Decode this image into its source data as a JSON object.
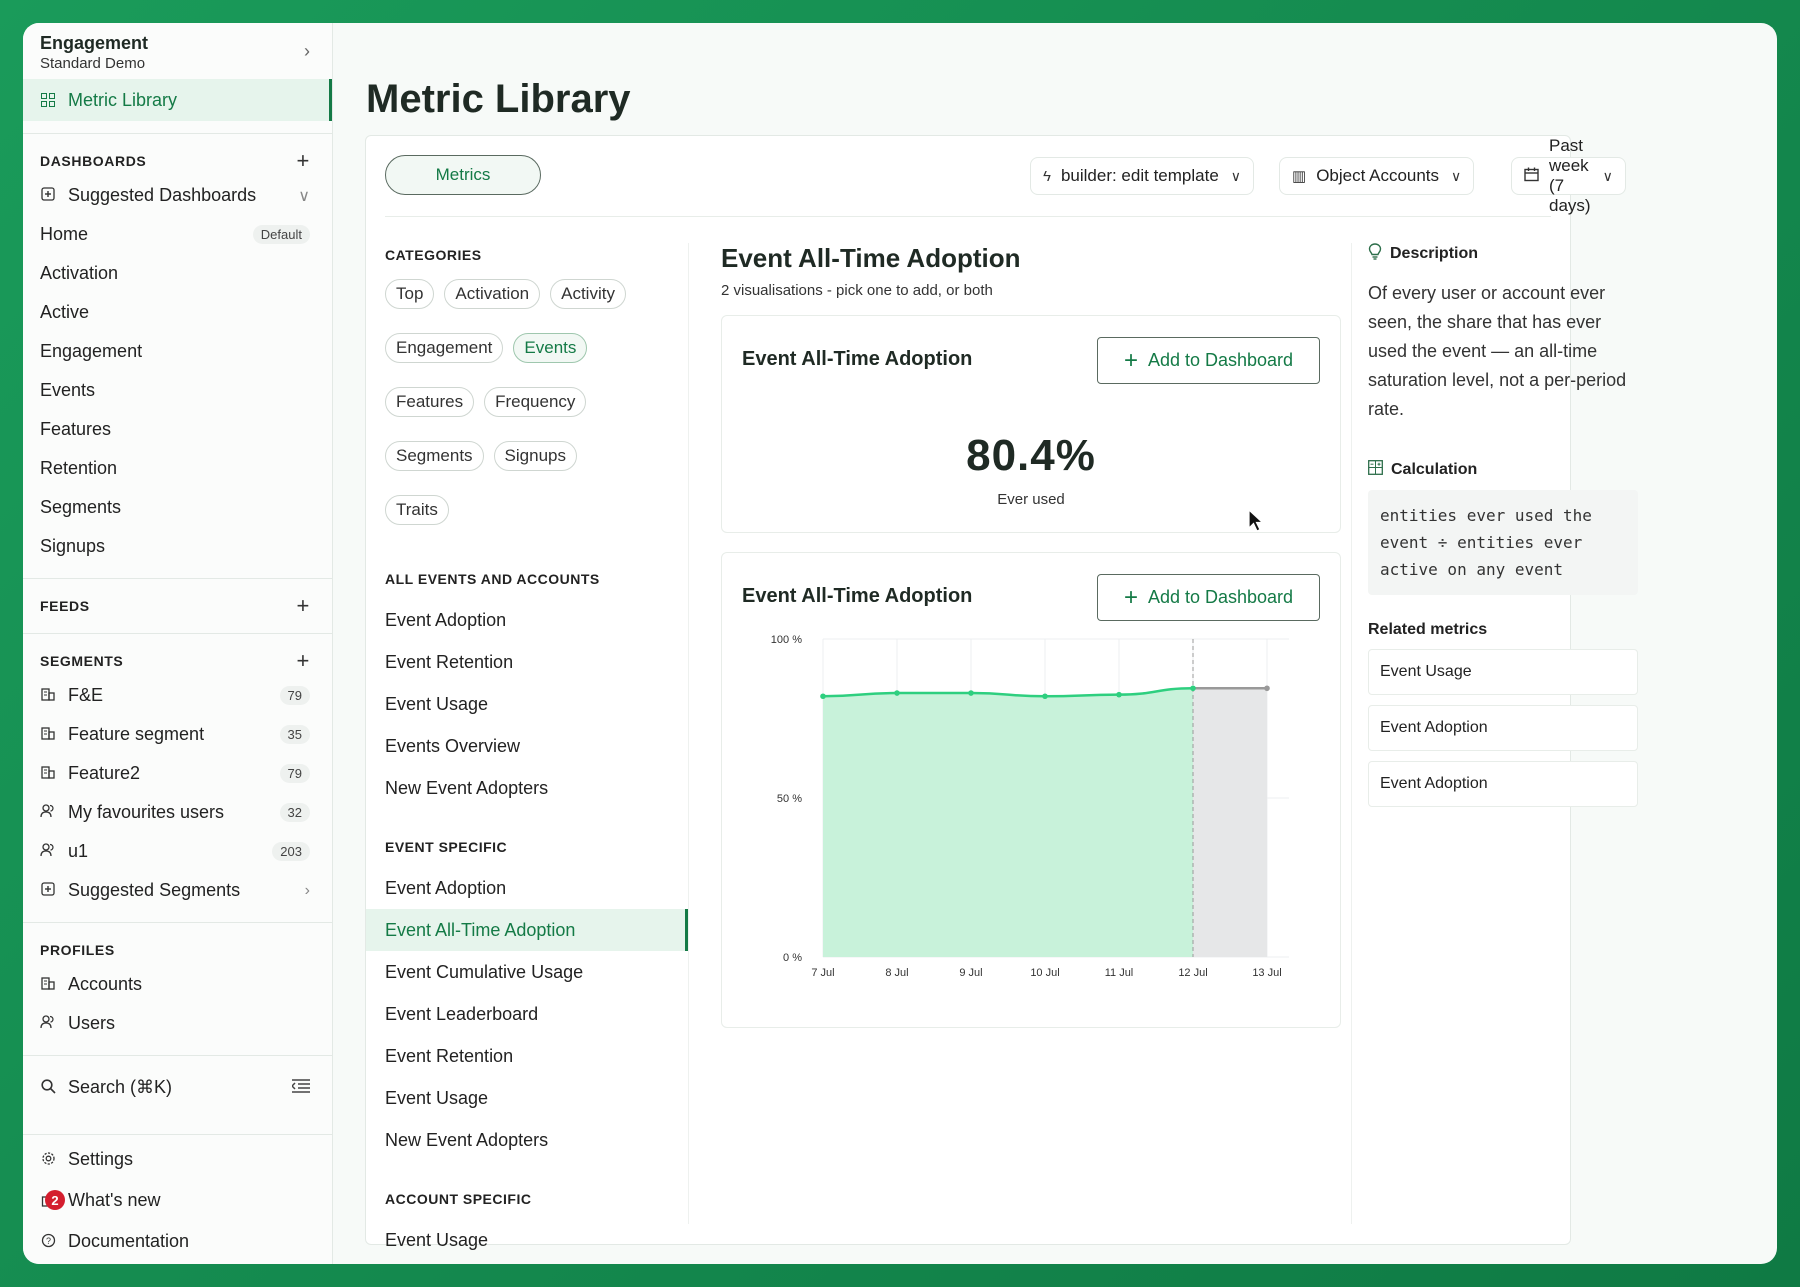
{
  "sidebar": {
    "org_name": "Engagement",
    "org_sub": "Standard Demo",
    "active_nav": "Metric Library",
    "dashboards_header": "DASHBOARDS",
    "dashboards": [
      {
        "label": "Suggested Dashboards",
        "icon": "star-plus-icon"
      },
      {
        "label": "Home",
        "badge": "Default"
      },
      {
        "label": "Activation"
      },
      {
        "label": "Active"
      },
      {
        "label": "Engagement"
      },
      {
        "label": "Events"
      },
      {
        "label": "Features"
      },
      {
        "label": "Retention"
      },
      {
        "label": "Segments"
      },
      {
        "label": "Signups"
      }
    ],
    "feeds_header": "FEEDS",
    "segments_header": "SEGMENTS",
    "segments": [
      {
        "label": "F&E",
        "count": "79",
        "icon": "building-icon"
      },
      {
        "label": "Feature segment",
        "count": "35",
        "icon": "building-icon"
      },
      {
        "label": "Feature2",
        "count": "79",
        "icon": "building-icon"
      },
      {
        "label": "My favourites users",
        "count": "32",
        "icon": "users-icon"
      },
      {
        "label": "u1",
        "count": "203",
        "icon": "users-icon"
      },
      {
        "label": "Suggested Segments",
        "icon": "star-plus-icon"
      }
    ],
    "profiles_header": "PROFILES",
    "profiles": [
      {
        "label": "Accounts",
        "icon": "building-icon"
      },
      {
        "label": "Users",
        "icon": "users-icon"
      }
    ],
    "search_label": "Search (⌘K)",
    "bottom": [
      {
        "label": "Settings",
        "icon": "gear-icon"
      },
      {
        "label": "What's new",
        "icon": "gift-icon",
        "notif": "2"
      },
      {
        "label": "Documentation",
        "icon": "help-icon"
      }
    ]
  },
  "page": {
    "title": "Metric Library"
  },
  "toolbar": {
    "metrics_tab": "Metrics",
    "template": "builder: edit template",
    "object": "Object Accounts",
    "period": "Past week (7 days)"
  },
  "library": {
    "categories_header": "CATEGORIES",
    "categories": [
      {
        "label": "Top"
      },
      {
        "label": "Activation"
      },
      {
        "label": "Activity"
      },
      {
        "label": "Engagement"
      },
      {
        "label": "Events",
        "active": true
      },
      {
        "label": "Features"
      },
      {
        "label": "Frequency"
      },
      {
        "label": "Segments"
      },
      {
        "label": "Signups"
      },
      {
        "label": "Traits"
      }
    ],
    "groups": [
      {
        "header": "ALL EVENTS AND ACCOUNTS",
        "items": [
          "Event Adoption",
          "Event Retention",
          "Event Usage",
          "Events Overview",
          "New Event Adopters"
        ]
      },
      {
        "header": "EVENT SPECIFIC",
        "items": [
          "Event Adoption",
          "Event All-Time Adoption",
          "Event Cumulative Usage",
          "Event Leaderboard",
          "Event Retention",
          "Event Usage",
          "New Event Adopters"
        ]
      },
      {
        "header": "ACCOUNT SPECIFIC",
        "items": [
          "Event Usage"
        ]
      }
    ],
    "active_item": "Event All-Time Adoption"
  },
  "metric": {
    "title": "Event All-Time Adoption",
    "subtitle": "2 visualisations - pick one to add, or both",
    "viz1": {
      "title": "Event All-Time Adoption",
      "add_label": "Add to Dashboard",
      "value": "80.4%",
      "value_label": "Ever used"
    },
    "viz2": {
      "title": "Event All-Time Adoption",
      "add_label": "Add to Dashboard"
    }
  },
  "details": {
    "description_header": "Description",
    "description": "Of every user or account ever seen, the share that has ever used the event — an all-time saturation level, not a per-period rate.",
    "calculation_header": "Calculation",
    "calculation": "entities ever used the event ÷ entities ever active on any event",
    "related_header": "Related metrics",
    "related": [
      "Event Usage",
      "Event Adoption",
      "Event Adoption"
    ]
  },
  "chart_data": {
    "type": "area",
    "categories": [
      "7 Jul",
      "8 Jul",
      "9 Jul",
      "10 Jul",
      "11 Jul",
      "12 Jul",
      "13 Jul"
    ],
    "values": [
      82,
      83,
      83,
      82,
      82.5,
      84.5,
      84.5
    ],
    "ylim": [
      0,
      100
    ],
    "yticks": [
      "100 %",
      "50 %",
      "0 %"
    ],
    "incomplete_from_index": 5,
    "colors": {
      "line": "#2ecf7f",
      "fill": "#c8f2da",
      "incomplete_fill": "#e6e7e8",
      "incomplete_line": "#999999"
    }
  }
}
